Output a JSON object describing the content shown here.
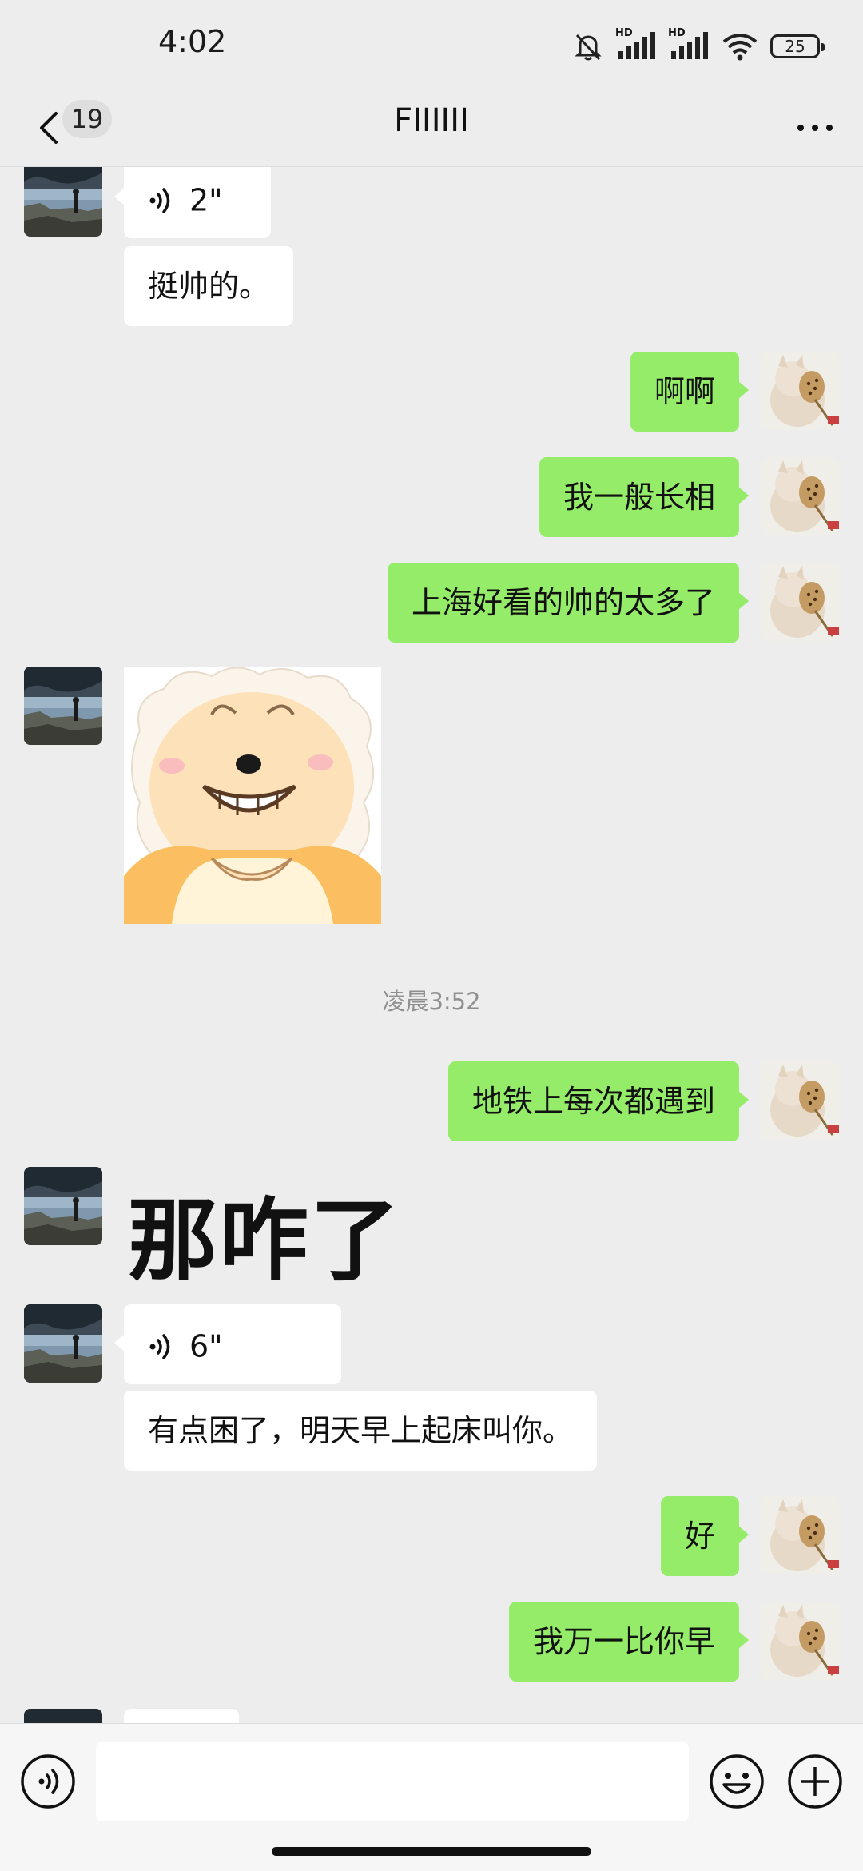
{
  "status_bar": {
    "time": "4:02",
    "battery": "25",
    "signal_label_1": "HD",
    "signal_label_2": "HD"
  },
  "nav": {
    "unread_count": "19",
    "title": "FIIIIII"
  },
  "messages": {
    "m1_voice_duration": "2\"",
    "m2_text": "挺帅的。",
    "m3_text": "啊啊",
    "m4_text": "我一般长相",
    "m5_text": "上海好看的帅的太多了",
    "timestamp": "凌晨3:52",
    "m7_text": "地铁上每次都遇到",
    "m8_big_text": "那咋了",
    "m9_voice_duration": "6\"",
    "m10_text": "有点困了，明天早上起床叫你。",
    "m11_text": "好",
    "m12_text": "我万一比你早"
  },
  "input": {
    "placeholder": ""
  },
  "colors": {
    "background": "#ededed",
    "incoming_bubble": "#ffffff",
    "outgoing_bubble": "#95ec69",
    "timestamp": "#8f8f8f"
  },
  "icons": [
    "back-icon",
    "more-icon",
    "voice-wave-icon",
    "emoji-icon",
    "plus-icon",
    "mute-bell-icon",
    "wifi-icon",
    "battery-icon"
  ]
}
